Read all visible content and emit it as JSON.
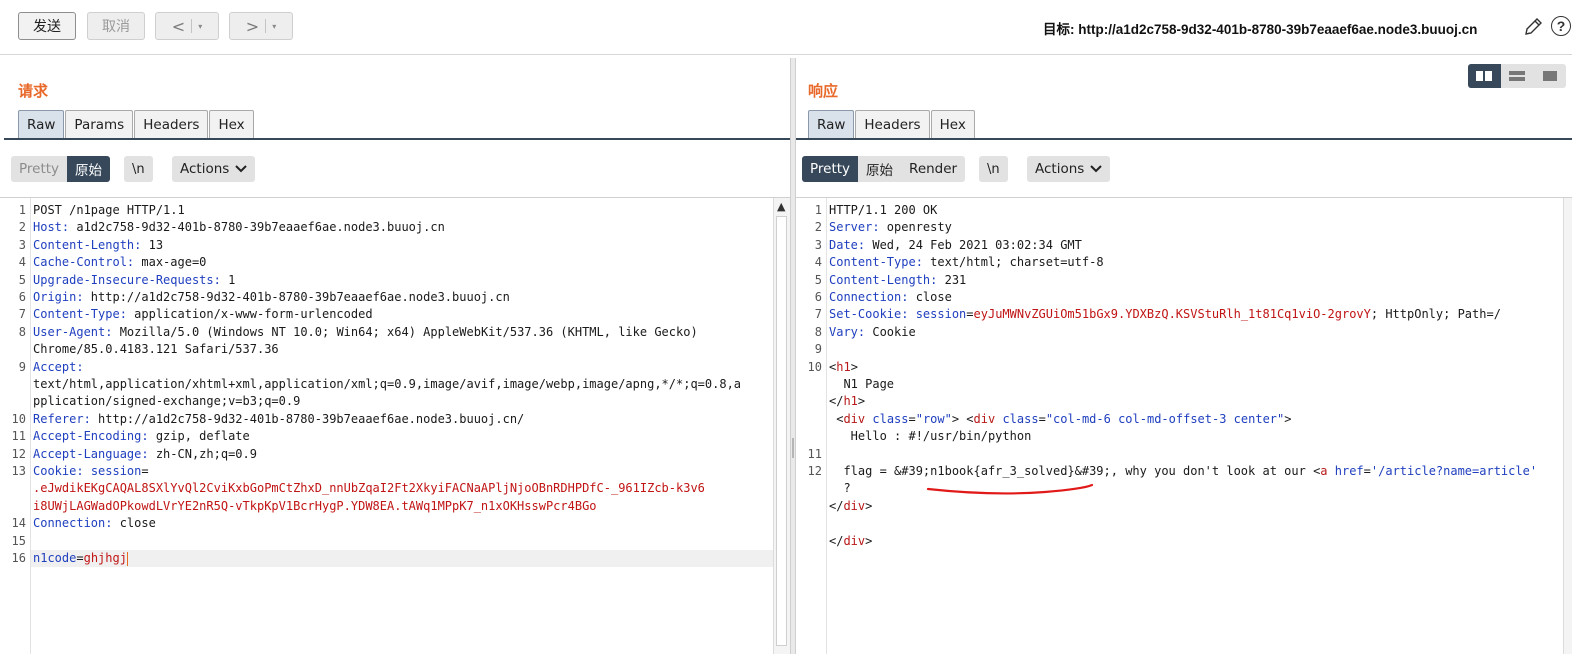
{
  "toolbar": {
    "send_label": "发送",
    "cancel_label": "取消",
    "back_glyph": "<",
    "forward_glyph": ">",
    "dropdown_glyph": "▾",
    "target_label": "目标:",
    "target_url": "http://a1d2c758-9d32-401b-8780-39b7eaaef6ae.node3.buuoj.cn",
    "edit_icon": "pencil-icon",
    "help_label": "?"
  },
  "request": {
    "title": "请求",
    "tabs": [
      "Raw",
      "Params",
      "Headers",
      "Hex"
    ],
    "active_tab": "Raw",
    "view_modes": [
      "Pretty",
      "原始"
    ],
    "active_view": "原始",
    "newline_label": "\\n",
    "actions_label": "Actions",
    "lines": [
      {
        "n": "1",
        "text": "POST /n1page HTTP/1.1"
      },
      {
        "n": "2",
        "key": "Host",
        "val": " a1d2c758-9d32-401b-8780-39b7eaaef6ae.node3.buuoj.cn"
      },
      {
        "n": "3",
        "key": "Content-Length",
        "val": " 13"
      },
      {
        "n": "4",
        "key": "Cache-Control",
        "val": " max-age=0"
      },
      {
        "n": "5",
        "key": "Upgrade-Insecure-Requests",
        "val": " 1"
      },
      {
        "n": "6",
        "key": "Origin",
        "val": " http://a1d2c758-9d32-401b-8780-39b7eaaef6ae.node3.buuoj.cn"
      },
      {
        "n": "7",
        "key": "Content-Type",
        "val": " application/x-www-form-urlencoded"
      },
      {
        "n": "8",
        "key": "User-Agent",
        "val": " Mozilla/5.0 (Windows NT 10.0; Win64; x64) AppleWebKit/537.36 (KHTML, like Gecko)"
      },
      {
        "n": "",
        "text": "Chrome/85.0.4183.121 Safari/537.36"
      },
      {
        "n": "9",
        "key": "Accept",
        "val": ""
      },
      {
        "n": "",
        "text": "text/html,application/xhtml+xml,application/xml;q=0.9,image/avif,image/webp,image/apng,*/*;q=0.8,a"
      },
      {
        "n": "",
        "text": "pplication/signed-exchange;v=b3;q=0.9"
      },
      {
        "n": "10",
        "key": "Referer",
        "val": " http://a1d2c758-9d32-401b-8780-39b7eaaef6ae.node3.buuoj.cn/"
      },
      {
        "n": "11",
        "key": "Accept-Encoding",
        "val": " gzip, deflate"
      },
      {
        "n": "12",
        "key": "Accept-Language",
        "val": " zh-CN,zh;q=0.9"
      },
      {
        "n": "13",
        "key": "Cookie",
        "val": "",
        "cookie_name": "session"
      },
      {
        "n": "",
        "red": ".eJwdikEKgCAQAL8SXlYvQl2CviKxbGoPmCtZhxD_nnUbZqaI2Ft2XkyiFACNaAPljNjoOBnRDHPDfC-_961IZcb-k3v6"
      },
      {
        "n": "",
        "red": "i8UWjLAGWadOPkowdLVrYE2nR5Q-vTkpKpV1BcrHygP.YDW8EA.tAWq1MPpK7_n1xOKHsswPcr4BGo"
      },
      {
        "n": "14",
        "key": "Connection",
        "val": " close"
      },
      {
        "n": "15",
        "text": ""
      },
      {
        "n": "16",
        "body_key": "n1code",
        "body_val": "ghjhgj"
      }
    ]
  },
  "response": {
    "title": "响应",
    "tabs": [
      "Raw",
      "Headers",
      "Hex"
    ],
    "active_tab": "Raw",
    "view_modes": [
      "Pretty",
      "原始",
      "Render"
    ],
    "active_view": "Pretty",
    "newline_label": "\\n",
    "actions_label": "Actions",
    "lines": [
      {
        "n": "1",
        "text": "HTTP/1.1 200 OK"
      },
      {
        "n": "2",
        "key": "Server",
        "val": " openresty"
      },
      {
        "n": "3",
        "key": "Date",
        "val": " Wed, 24 Feb 2021 03:02:34 GMT"
      },
      {
        "n": "4",
        "key": "Content-Type",
        "val": " text/html; charset=utf-8"
      },
      {
        "n": "5",
        "key": "Content-Length",
        "val": " 231"
      },
      {
        "n": "6",
        "key": "Connection",
        "val": " close"
      },
      {
        "n": "7",
        "key": "Set-Cookie",
        "val_name": " session",
        "val_eq": "=",
        "val_red": "eyJuMWNvZGUiOm51bGx9.YDXBzQ.KSVStuRlh_1t81Cq1viO-2grovY",
        "val_tail": "; HttpOnly; Path=/"
      },
      {
        "n": "8",
        "key": "Vary",
        "val": " Cookie"
      },
      {
        "n": "9",
        "text": ""
      },
      {
        "n": "10",
        "tag_open": "h1"
      },
      {
        "n": "",
        "text": "  N1 Page"
      },
      {
        "n": "",
        "tag_close": "h1"
      },
      {
        "n": "",
        "div_line": true
      },
      {
        "n": "",
        "text": "   Hello : #!/usr/bin/python"
      },
      {
        "n": "11",
        "text": ""
      },
      {
        "n": "12",
        "flag_line": true,
        "flag_prefix": "  flag = &#39;n1book{afr_3_solved}&#39;, why you don't look at our ",
        "a_tag": "a",
        "href_attr": "href",
        "href_val": "'/article?name=article'"
      },
      {
        "n": "",
        "text": "  ?"
      },
      {
        "n": "",
        "tag_close": "div"
      },
      {
        "n": "",
        "text": ""
      },
      {
        "n": "",
        "tag_close": "div"
      }
    ],
    "div_line": {
      "tag": "div",
      "attr": "class",
      "val1": "\"row\"",
      "val2": "\"col-md-6 col-md-offset-3 center\""
    }
  }
}
